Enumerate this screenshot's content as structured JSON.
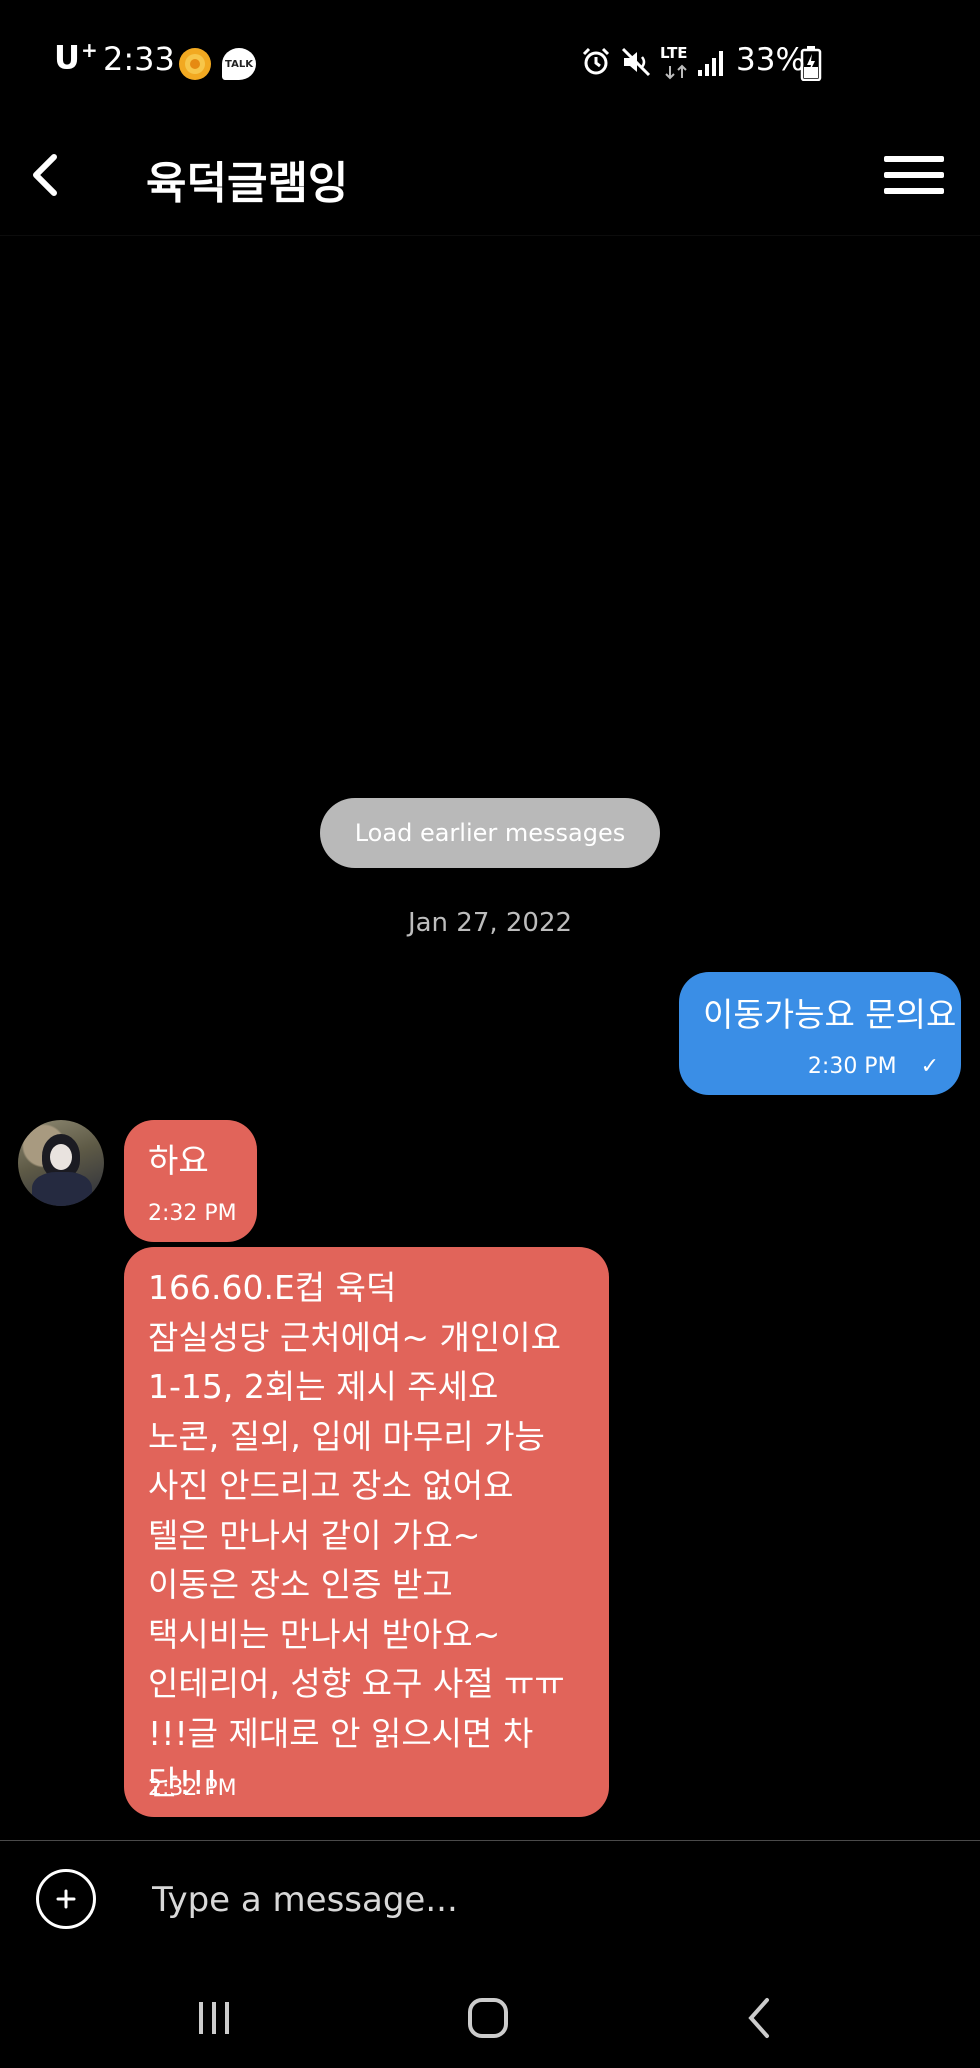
{
  "status_bar": {
    "carrier": "U",
    "carrier_sup": "+",
    "time": "2:33",
    "notif_yellow_text": "",
    "notif_talk_text": "TALK",
    "network": "LTE",
    "battery": "33%"
  },
  "header": {
    "title": "육덕글램잉"
  },
  "load_earlier_label": "Load earlier messages",
  "date_separator": "Jan 27, 2022",
  "messages": [
    {
      "direction": "outgoing",
      "text": "이동가능요 문의요",
      "time": "2:30 PM",
      "status": "✓"
    },
    {
      "direction": "incoming",
      "text": "하요",
      "time": "2:32 PM"
    },
    {
      "direction": "incoming",
      "text": "166.60.E컵 육덕\n잠실성당 근처에여~ 개인이요\n1-15, 2회는 제시 주세요\n노콘, 질외, 입에 마무리 가능\n사진 안드리고 장소 없어요\n텔은 만나서 같이 가요~\n이동은 장소 인증 받고\n택시비는 만나서 받아요~\n인테리어, 성향 요구 사절 ㅠㅠ\n!!!글 제대로 안 읽으시면 차단!!!",
      "time": "2:32 PM"
    }
  ],
  "composer": {
    "placeholder": "Type a message..."
  },
  "colors": {
    "background": "#000000",
    "outgoing_bubble": "#3a8ee6",
    "incoming_bubble": "#e1645a",
    "load_earlier_bg": "#b9b9b9"
  },
  "icons": {
    "back": "chevron-left-icon",
    "menu": "hamburger-menu-icon",
    "add": "plus-circle-icon",
    "nav_recent": "recent-apps-icon",
    "nav_home": "home-icon",
    "nav_back": "nav-back-icon"
  }
}
